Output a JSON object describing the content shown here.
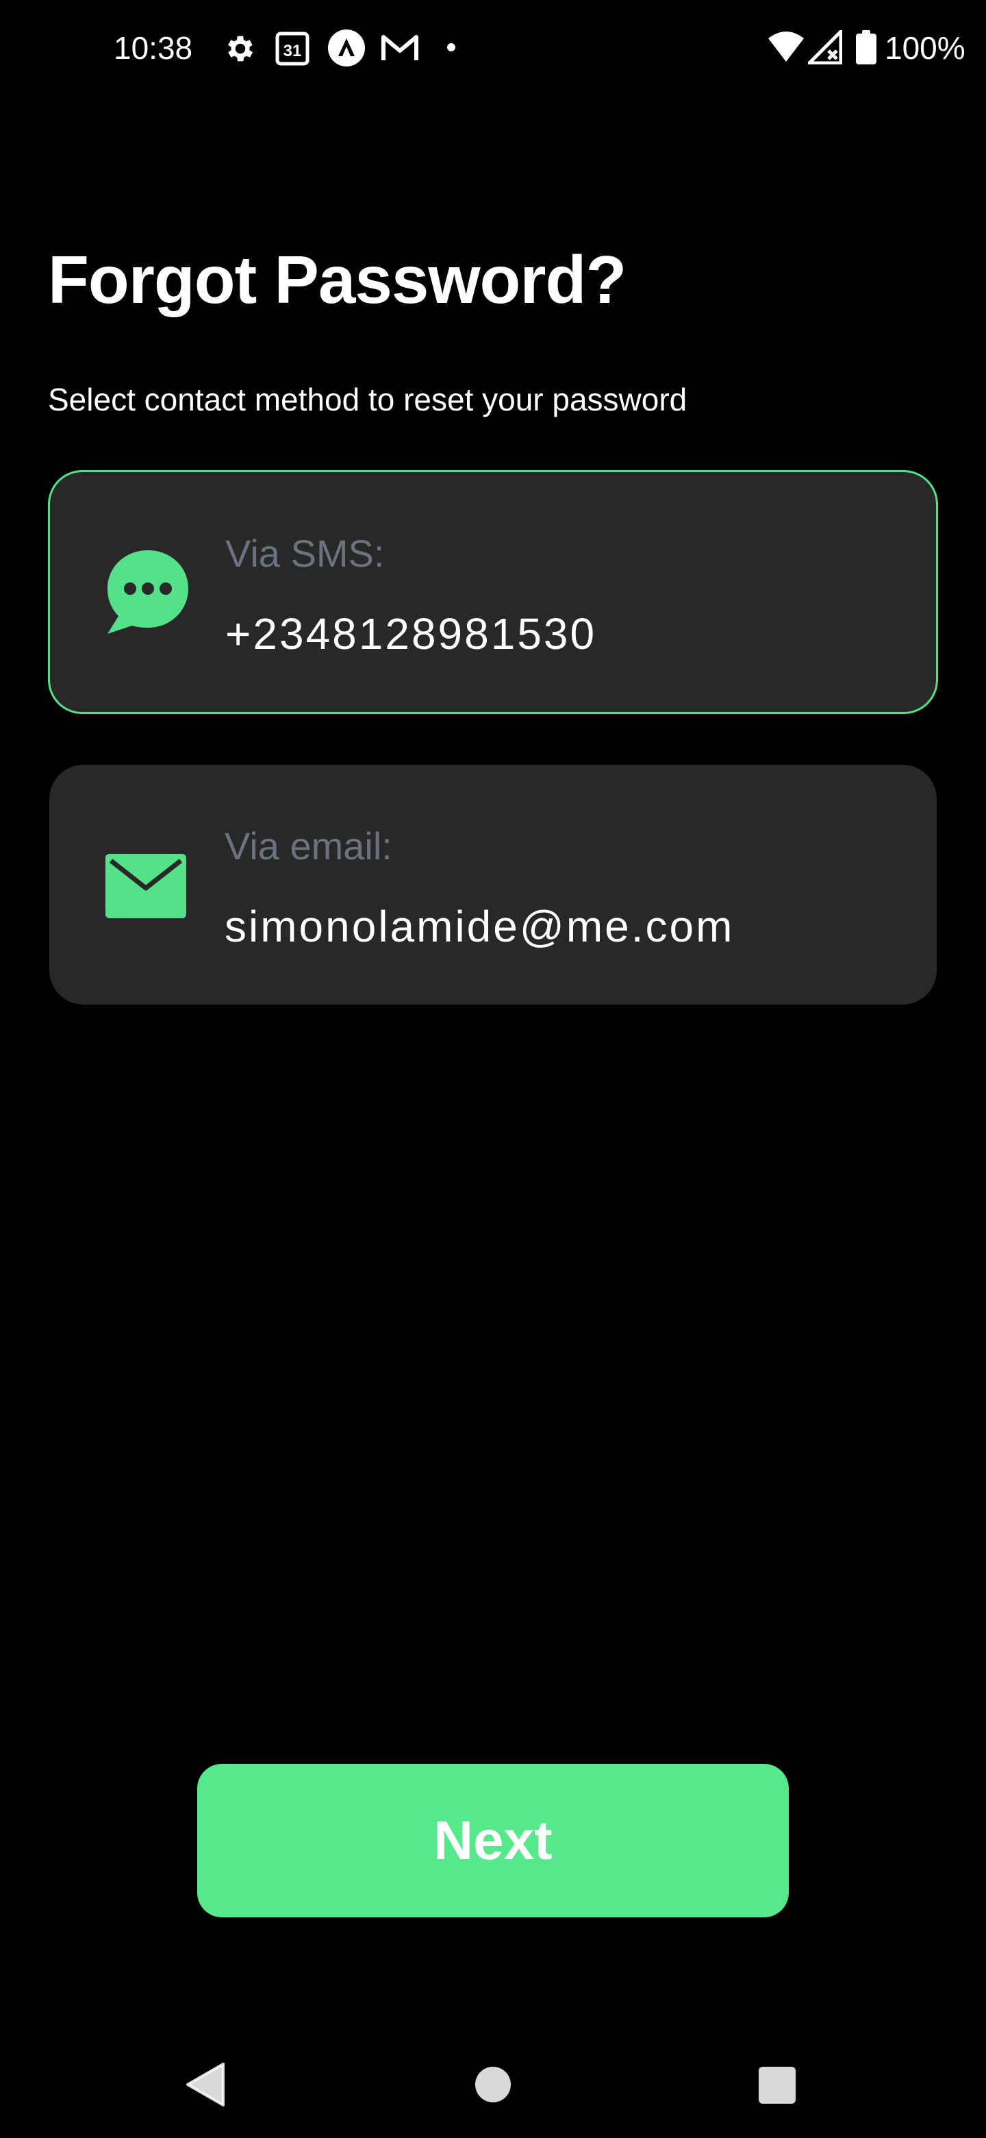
{
  "status_bar": {
    "time": "10:38",
    "battery": "100%",
    "calendar_day": "31",
    "icons": [
      "gear-icon",
      "calendar-icon",
      "a-circle-icon",
      "gmail-icon",
      "dot-icon",
      "wifi-icon",
      "signal-icon",
      "battery-icon"
    ]
  },
  "page": {
    "title": "Forgot Password?",
    "subtitle": "Select contact method to reset your password"
  },
  "methods": [
    {
      "label": "Via SMS:",
      "value": "+2348128981530",
      "icon": "chat-bubble-icon",
      "selected": true
    },
    {
      "label": "Via email:",
      "value": "simonolamide@me.com",
      "icon": "mail-icon",
      "selected": false
    }
  ],
  "next_button": {
    "label": "Next"
  },
  "nav": {
    "items": [
      "back-icon",
      "home-icon",
      "recents-icon"
    ]
  },
  "colors": {
    "background": "#000000",
    "accent": "#55e98c",
    "card": "#282828",
    "muted_text": "#6b7280"
  }
}
